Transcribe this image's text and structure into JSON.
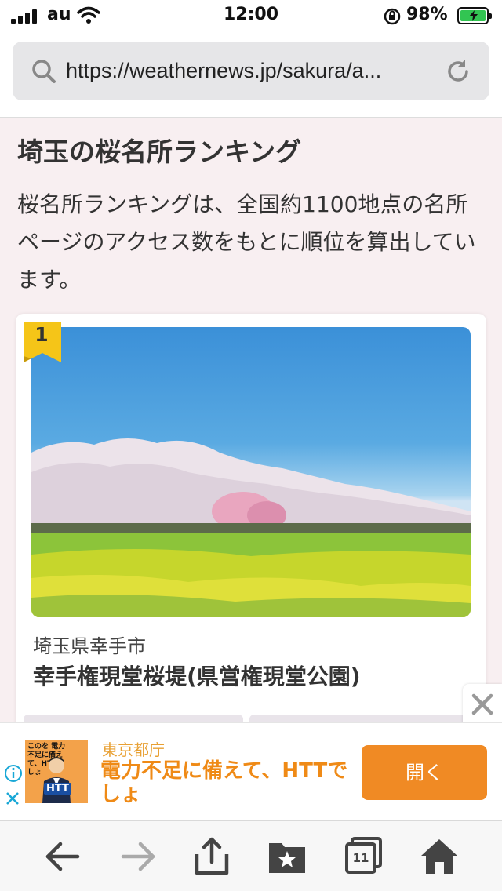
{
  "status_bar": {
    "carrier": "au",
    "time": "12:00",
    "battery_percent": "98%"
  },
  "browser": {
    "url": "https://weathernews.jp/sakura/a..."
  },
  "page": {
    "title": "埼玉の桜名所ランキング",
    "description": "桜名所ランキングは、全国約1100地点の名所ページのアクセス数をもとに順位を算出しています。"
  },
  "ranking": [
    {
      "rank": "1",
      "prefecture_city": "埼玉県幸手市",
      "name": "幸手権現堂桜堤(県営権現堂公園)"
    }
  ],
  "ad": {
    "thumb_text": "このを 電力不足に備えて、HTTでしょ",
    "thumb_logo": "HTT",
    "sponsor": "東京都庁",
    "headline": "電力不足に備えて、HTTでしょ",
    "open_button": "開く"
  },
  "toolbar": {
    "tab_count": "11"
  },
  "colors": {
    "page_background": "#f8eff1",
    "badge_gold": "#f5c518",
    "ad_orange": "#f08a24",
    "battery_green": "#32c552"
  }
}
